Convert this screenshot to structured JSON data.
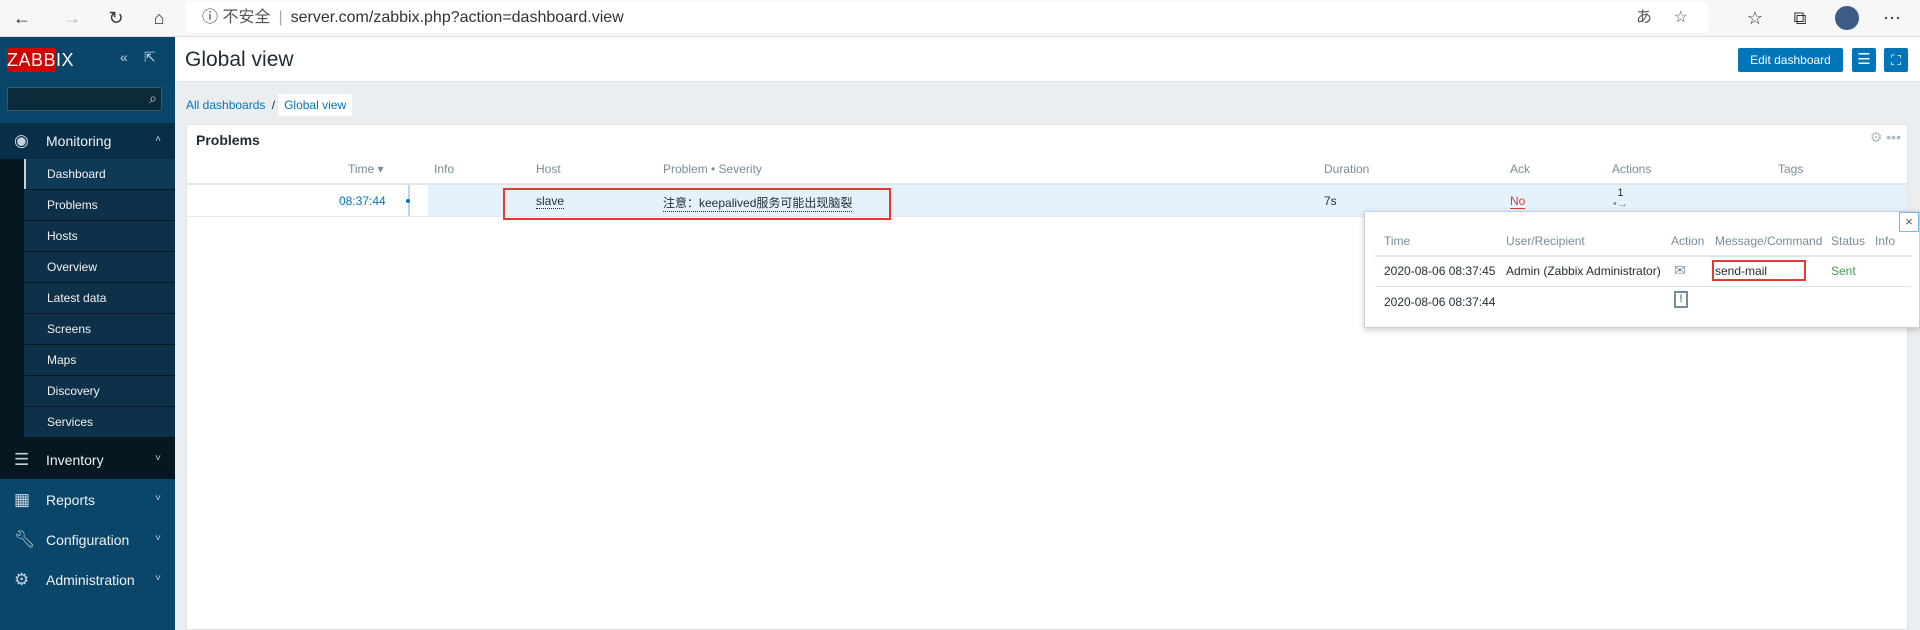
{
  "browser": {
    "insecure_label": "不安全",
    "url": "server.com/zabbix.php?action=dashboard.view"
  },
  "sidebar": {
    "logo": "ZABBIX",
    "monitoring": "Monitoring",
    "monitoring_items": [
      "Dashboard",
      "Problems",
      "Hosts",
      "Overview",
      "Latest data",
      "Screens",
      "Maps",
      "Discovery",
      "Services"
    ],
    "menus": [
      {
        "label": "Inventory",
        "icon": "list-icon"
      },
      {
        "label": "Reports",
        "icon": "chart-icon"
      },
      {
        "label": "Configuration",
        "icon": "wrench-icon"
      },
      {
        "label": "Administration",
        "icon": "gear-icon"
      }
    ]
  },
  "header": {
    "title": "Global view",
    "edit_button": "Edit dashboard"
  },
  "breadcrumb": {
    "all": "All dashboards",
    "separator": "/",
    "current": "Global view"
  },
  "widget": {
    "title": "Problems",
    "columns": [
      "Time ▾",
      "Info",
      "Host",
      "Problem • Severity",
      "Duration",
      "Ack",
      "Actions",
      "Tags"
    ],
    "rows": [
      {
        "time": "08:37:44",
        "host": "slave",
        "problem": "注意：keepalived服务可能出现脑裂",
        "duration": "7s",
        "ack": "No",
        "actions": "1"
      }
    ]
  },
  "popup": {
    "columns": [
      "Time",
      "User/Recipient",
      "Action",
      "Message/Command",
      "Status",
      "Info"
    ],
    "rows": [
      {
        "time": "2020-08-06 08:37:45",
        "user": "Admin (Zabbix Administrator)",
        "action_icon": "mail-icon",
        "message": "send-mail",
        "status": "Sent"
      },
      {
        "time": "2020-08-06 08:37:44",
        "user": "",
        "action_icon": "calendar-alert-icon",
        "message": "",
        "status": ""
      }
    ],
    "close": "×"
  },
  "colors": {
    "accent": "#0275b8",
    "sidebar": "#0a466a",
    "ack_no": "#e53935",
    "sent": "#429e47",
    "highlight": "#e53935"
  }
}
